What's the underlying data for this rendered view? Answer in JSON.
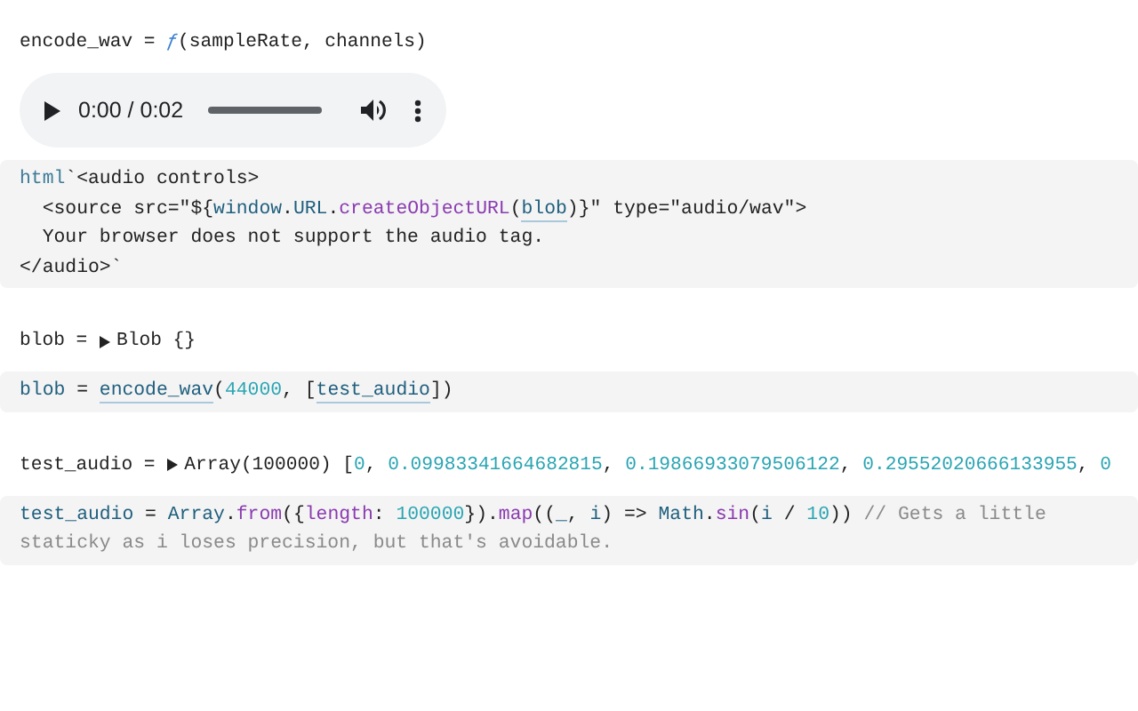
{
  "cells": [
    {
      "kind": "output",
      "tokens": [
        {
          "kind": "plain",
          "text": "encode_wav = "
        },
        {
          "kind": "fn",
          "text": "ƒ"
        },
        {
          "kind": "plain",
          "text": "(sampleRate, channels)"
        }
      ]
    },
    {
      "kind": "audio",
      "time": "0:00 / 0:02"
    },
    {
      "kind": "code",
      "lines": [
        [
          {
            "kind": "tag",
            "text": "html"
          },
          {
            "kind": "plain",
            "text": "`<audio controls>"
          }
        ],
        [
          {
            "kind": "plain",
            "text": "  <source src=\"${"
          },
          {
            "kind": "var",
            "text": "window"
          },
          {
            "kind": "plain",
            "text": "."
          },
          {
            "kind": "var",
            "text": "URL"
          },
          {
            "kind": "plain",
            "text": "."
          },
          {
            "kind": "prop",
            "text": "createObjectURL"
          },
          {
            "kind": "plain",
            "text": "("
          },
          {
            "kind": "ref",
            "text": "blob"
          },
          {
            "kind": "plain",
            "text": ")}\" type=\"audio/wav\">"
          }
        ],
        [
          {
            "kind": "plain",
            "text": "  Your browser does not support the audio tag."
          }
        ],
        [
          {
            "kind": "plain",
            "text": "</audio>`"
          }
        ]
      ]
    },
    {
      "kind": "output",
      "expanded": false,
      "name": "blob = ",
      "tokens": [
        {
          "kind": "plain",
          "text": "Blob {}"
        }
      ]
    },
    {
      "kind": "code",
      "lines": [
        [
          {
            "kind": "var",
            "text": "blob"
          },
          {
            "kind": "plain",
            "text": " = "
          },
          {
            "kind": "ref",
            "text": "encode_wav"
          },
          {
            "kind": "plain",
            "text": "("
          },
          {
            "kind": "num",
            "text": "44000"
          },
          {
            "kind": "plain",
            "text": ", ["
          },
          {
            "kind": "ref",
            "text": "test_audio"
          },
          {
            "kind": "plain",
            "text": "])"
          }
        ]
      ]
    },
    {
      "kind": "output",
      "expanded": false,
      "name": "test_audio = ",
      "tokens": [
        {
          "kind": "plain",
          "text": "Array(100000) ["
        },
        {
          "kind": "num",
          "text": "0"
        },
        {
          "kind": "plain",
          "text": ", "
        },
        {
          "kind": "num",
          "text": "0.09983341664682815"
        },
        {
          "kind": "plain",
          "text": ", "
        },
        {
          "kind": "num",
          "text": "0.19866933079506122"
        },
        {
          "kind": "plain",
          "text": ", "
        },
        {
          "kind": "num",
          "text": "0.29552020666133955"
        },
        {
          "kind": "plain",
          "text": ", "
        },
        {
          "kind": "num",
          "text": "0"
        }
      ]
    },
    {
      "kind": "code",
      "lines": [
        [
          {
            "kind": "var",
            "text": "test_audio"
          },
          {
            "kind": "plain",
            "text": " = "
          },
          {
            "kind": "var",
            "text": "Array"
          },
          {
            "kind": "plain",
            "text": "."
          },
          {
            "kind": "prop",
            "text": "from"
          },
          {
            "kind": "plain",
            "text": "({"
          },
          {
            "kind": "prop",
            "text": "length"
          },
          {
            "kind": "plain",
            "text": ": "
          },
          {
            "kind": "num",
            "text": "100000"
          },
          {
            "kind": "plain",
            "text": "})."
          },
          {
            "kind": "prop",
            "text": "map"
          },
          {
            "kind": "plain",
            "text": "(("
          },
          {
            "kind": "var",
            "text": "_"
          },
          {
            "kind": "plain",
            "text": ", "
          },
          {
            "kind": "var",
            "text": "i"
          },
          {
            "kind": "plain",
            "text": ") => "
          },
          {
            "kind": "var",
            "text": "Math"
          },
          {
            "kind": "plain",
            "text": "."
          },
          {
            "kind": "prop",
            "text": "sin"
          },
          {
            "kind": "plain",
            "text": "("
          },
          {
            "kind": "var",
            "text": "i"
          },
          {
            "kind": "plain",
            "text": " / "
          },
          {
            "kind": "num",
            "text": "10"
          },
          {
            "kind": "plain",
            "text": ")) "
          },
          {
            "kind": "comment",
            "text": "// Gets a little staticky as i loses precision, but that's avoidable."
          }
        ]
      ]
    }
  ]
}
